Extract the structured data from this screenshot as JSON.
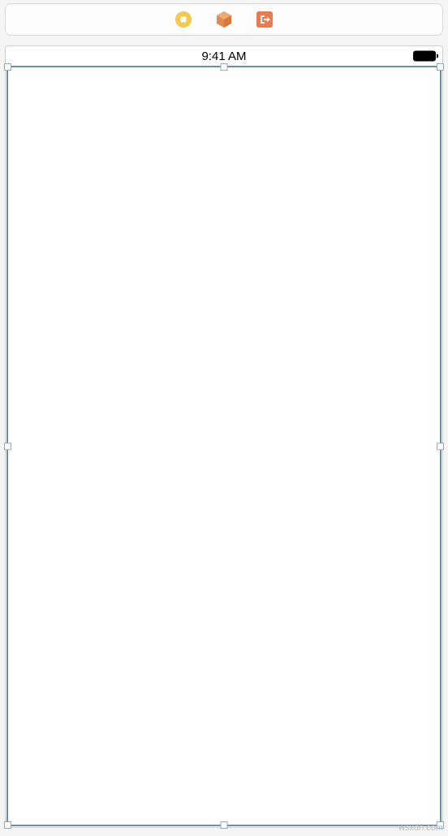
{
  "toolbar": {
    "icons": [
      "view-controller-icon",
      "first-responder-icon",
      "exit-icon"
    ]
  },
  "statusBar": {
    "time": "9:41 AM"
  },
  "watermark": "wsxdn.com"
}
